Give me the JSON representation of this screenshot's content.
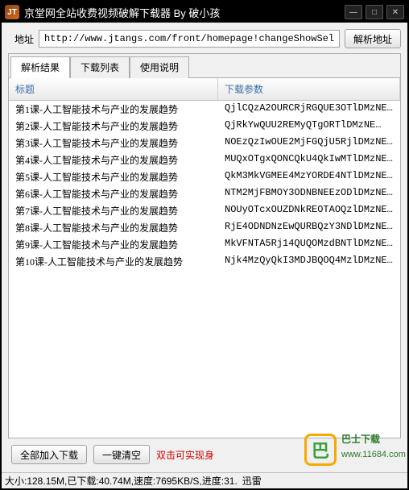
{
  "window": {
    "icon_text": "JT",
    "title": "京堂网全站收费视频破解下载器 By 破小孩"
  },
  "addr": {
    "label": "地址",
    "value": "http://www.jtangs.com/front/homepage!changeShowSellWay",
    "parse_btn": "解析地址"
  },
  "tabs": {
    "items": [
      "解析结果",
      "下载列表",
      "使用说明"
    ],
    "active_index": 0
  },
  "grid": {
    "headers": [
      "标题",
      "下载参数"
    ],
    "rows": [
      {
        "title": "第1课-人工智能技术与产业的发展趋势",
        "param": "QjlCQzA2OURCRjRGQUE3OTlDMzNE…"
      },
      {
        "title": "第2课-人工智能技术与产业的发展趋势",
        "param": "QjRkYwQUU2REMyQTgORTlDMzNE…"
      },
      {
        "title": "第3课-人工智能技术与产业的发展趋势",
        "param": "NOEzQzIwOUE2MjFGQjU5RjlDMzNE…"
      },
      {
        "title": "第4课-人工智能技术与产业的发展趋势",
        "param": "MUQxOTgxQONCQkU4QkIwMTlDMzNE…"
      },
      {
        "title": "第5课-人工智能技术与产业的发展趋势",
        "param": "QkM3MkVGMEE4MzYORDE4NTlDMzNE…"
      },
      {
        "title": "第6课-人工智能技术与产业的发展趋势",
        "param": "NTM2MjFBMOY3ODNBNEEzODlDMzNE…"
      },
      {
        "title": "第7课-人工智能技术与产业的发展趋势",
        "param": "NOUyOTcxOUZDNkREOTAOQzlDMzNE…"
      },
      {
        "title": "第8课-人工智能技术与产业的发展趋势",
        "param": "RjE4ODNDNzEwQURBQzY3NDlDMzNE…"
      },
      {
        "title": "第9课-人工智能技术与产业的发展趋势",
        "param": "MkVFNTA5Rj14QUQOMzdBNTlDMzNE…"
      },
      {
        "title": "第10课-人工智能技术与产业的发展趋势",
        "param": "Njk4MzQyQkI3MDJBQOQ4MzlDMzNE…"
      }
    ]
  },
  "bottom": {
    "add_all": "全部加入下载",
    "clear": "一键清空",
    "hint": "双击可实现身"
  },
  "status": {
    "size": "大小:128.15M,已下载:40.74M,速度:7695KB/S,进度:31.",
    "engine": "迅雷"
  },
  "watermark": {
    "name": "巴士下载",
    "url": "www.11684.com",
    "mark": "巴"
  }
}
